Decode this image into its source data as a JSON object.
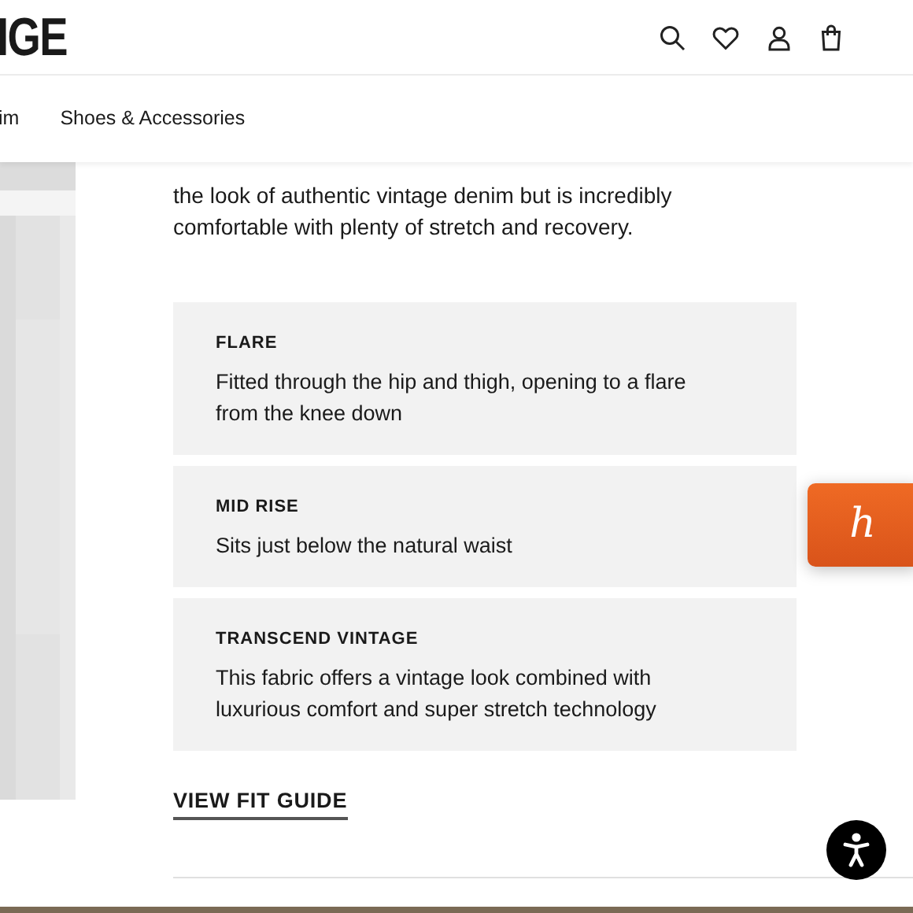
{
  "header": {
    "logo": "IGE"
  },
  "nav": {
    "items": [
      "im",
      "Shoes & Accessories"
    ]
  },
  "description": [
    "the look of authentic vintage denim but is incredibly",
    "comfortable with plenty of stretch and recovery."
  ],
  "features": [
    {
      "title": "FLARE",
      "text": "Fitted through the hip and thigh, opening to a flare from the knee down"
    },
    {
      "title": "MID RISE",
      "text": "Sits just below the natural waist"
    },
    {
      "title": "TRANSCEND VINTAGE",
      "text": "This fabric offers a vintage look combined with luxurious comfort and super stretch technology"
    }
  ],
  "fit_guide_link": "VIEW FIT GUIDE",
  "honey_button": {
    "label": "h"
  }
}
